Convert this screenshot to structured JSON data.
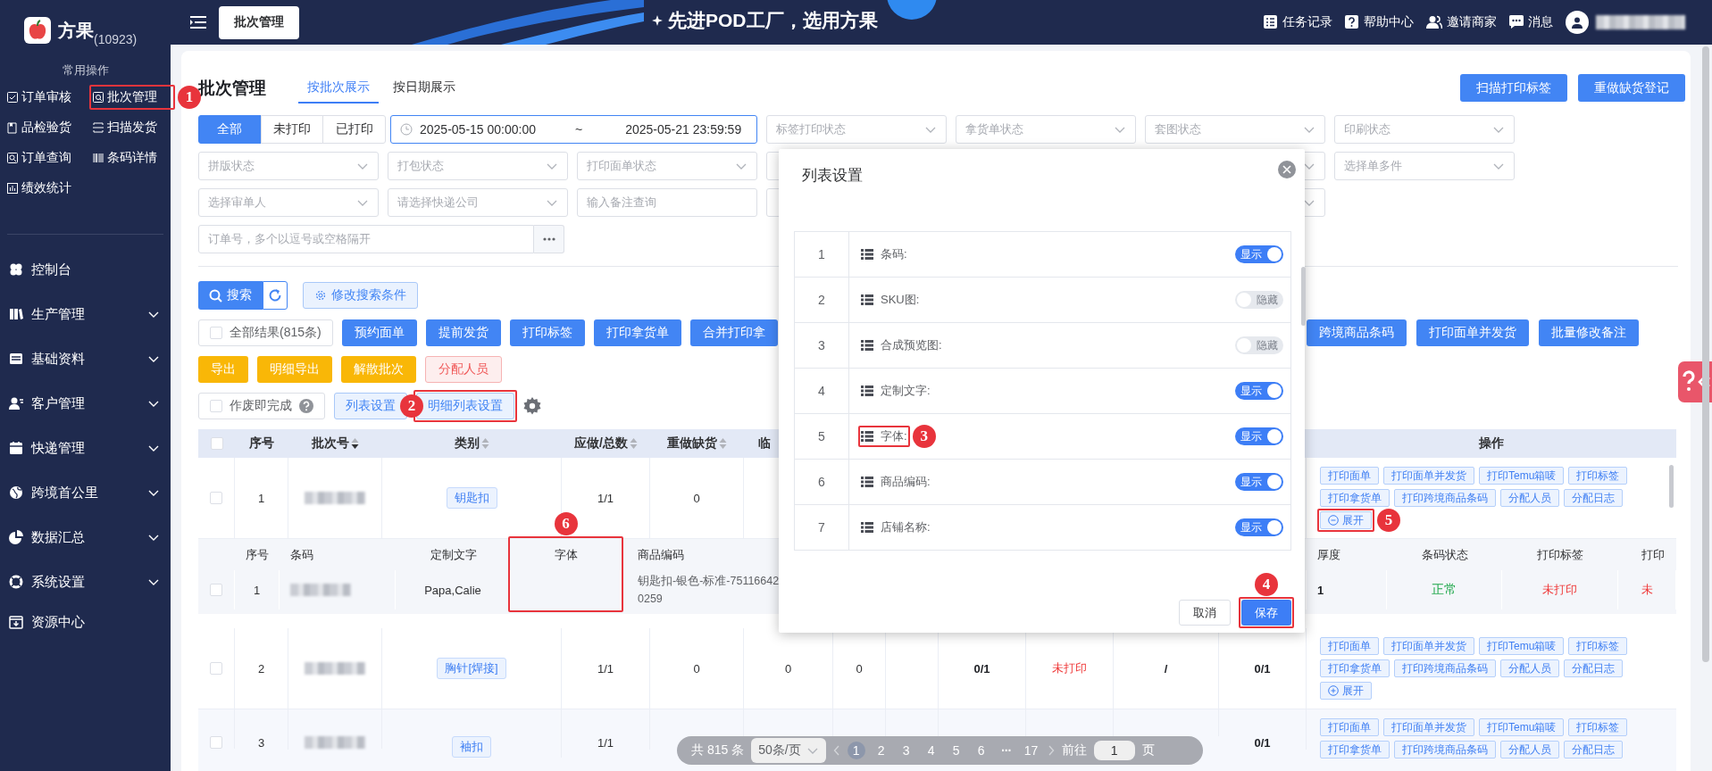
{
  "sidebar": {
    "logo": {
      "name": "方果",
      "count": "(10923)"
    },
    "quick_title": "常用操作",
    "quick_links": [
      {
        "label": "订单审核"
      },
      {
        "label": "批次管理",
        "callout": "1"
      },
      {
        "label": "品检验货"
      },
      {
        "label": "扫描发货"
      },
      {
        "label": "订单查询"
      },
      {
        "label": "条码详情"
      },
      {
        "label": "绩效统计"
      }
    ],
    "menu": [
      {
        "label": "控制台",
        "kind": "link"
      },
      {
        "label": "生产管理",
        "kind": "group",
        "expanded": false
      },
      {
        "label": "基础资料",
        "kind": "group",
        "expanded": false
      },
      {
        "label": "客户管理",
        "kind": "group",
        "expanded": false
      },
      {
        "label": "快递管理",
        "kind": "group",
        "expanded": false
      },
      {
        "label": "跨境首公里",
        "kind": "group",
        "expanded": false
      },
      {
        "label": "数据汇总",
        "kind": "group",
        "expanded": false
      },
      {
        "label": "系统设置",
        "kind": "group",
        "expanded": false
      },
      {
        "label": "资源中心",
        "kind": "link"
      }
    ]
  },
  "topbar": {
    "tabs": [
      {
        "label": "批次管理",
        "selected": true
      }
    ],
    "slogan": "先进POD工厂，选用方果",
    "links": [
      "任务记录",
      "帮助中心",
      "邀请商家",
      "消息"
    ],
    "user": {
      "redacted": true
    }
  },
  "page": {
    "title": "批次管理",
    "view_tabs": [
      {
        "label": "按批次展示",
        "selected": true
      },
      {
        "label": "按日期展示",
        "selected": false
      }
    ],
    "actions": [
      "扫描打印标签",
      "重做缺货登记"
    ],
    "print_filter": [
      {
        "label": "全部",
        "selected": true
      },
      {
        "label": "未打印",
        "selected": false
      },
      {
        "label": "已打印",
        "selected": false
      }
    ],
    "date_range": {
      "start": "2025-05-15 00:00:00",
      "separator": "~",
      "end": "2025-05-21 23:59:59"
    },
    "filters": [
      {
        "kind": "select",
        "placeholder": "标签打印状态"
      },
      {
        "kind": "select",
        "placeholder": "拿货单状态"
      },
      {
        "kind": "select",
        "placeholder": "套图状态"
      },
      {
        "kind": "select",
        "placeholder": "印刷状态"
      },
      {
        "kind": "select",
        "placeholder": "拼版状态"
      },
      {
        "kind": "select",
        "placeholder": "打包状态"
      },
      {
        "kind": "select",
        "placeholder": "打印面单状态"
      },
      {
        "kind": "select"
      },
      {
        "kind": "select"
      },
      {
        "kind": "select",
        "placeholder": "选择单多件"
      },
      {
        "kind": "select",
        "placeholder": "选择审单人"
      },
      {
        "kind": "select",
        "placeholder": "请选择快递公司"
      },
      {
        "kind": "input",
        "placeholder": "输入备注查询"
      },
      {
        "kind": "select"
      },
      {
        "kind": "select"
      },
      {
        "kind": "order",
        "placeholder": "订单号，多个以逗号或空格隔开"
      }
    ],
    "search_button": "搜索",
    "modify_button": "修改搜索条件",
    "all_results": {
      "label": "全部结果(815条)",
      "checked": false
    },
    "bulk_left": [
      "预约面单",
      "提前发货",
      "打印标签",
      "打印拿货单",
      "合并打印拿"
    ],
    "bulk_right": [
      "跨境商品条码",
      "打印面单并发货",
      "批量修改备注"
    ],
    "secondary": [
      {
        "label": "导出",
        "kind": "warning"
      },
      {
        "label": "明细导出",
        "kind": "warning"
      },
      {
        "label": "解散批次",
        "kind": "warning"
      },
      {
        "label": "分配人员",
        "kind": "danger"
      }
    ],
    "void_done": {
      "label": "作废即完成",
      "checked": false
    },
    "list_settings": "列表设置",
    "detail_settings": {
      "label": "明细列表设置",
      "callout": "2"
    }
  },
  "table": {
    "header_checked": false,
    "columns": [
      {
        "kind": "text",
        "label": "序号"
      },
      {
        "kind": "sortable",
        "label": "批次号",
        "sorted": true
      },
      {
        "kind": "sortable",
        "label": "类别",
        "sorted": false
      },
      {
        "kind": "sortable",
        "label": "应做/总数",
        "sorted": false
      },
      {
        "kind": "sortable",
        "label": "重做缺货",
        "sorted": false
      },
      {
        "kind": "text",
        "label": "临"
      },
      {
        "kind": "blank"
      },
      {
        "kind": "blank"
      },
      {
        "kind": "blank"
      },
      {
        "kind": "blank"
      },
      {
        "kind": "blank"
      },
      {
        "kind": "blank"
      },
      {
        "kind": "text",
        "label": "操作"
      }
    ],
    "rows": [
      {
        "checked": false,
        "cells": [
          {
            "kind": "plain",
            "text": "1"
          },
          {
            "kind": "redacted"
          },
          {
            "kind": "tag",
            "text": "钥匙扣"
          },
          {
            "kind": "plain",
            "text": "1/1"
          },
          {
            "kind": "plain",
            "text": "0"
          },
          {
            "kind": "blank"
          },
          {
            "kind": "blank"
          },
          {
            "kind": "blank"
          },
          {
            "kind": "blank"
          },
          {
            "kind": "blank"
          },
          {
            "kind": "blank"
          },
          {
            "kind": "blank"
          }
        ],
        "actions": [
          "打印面单",
          "打印面单并发货",
          "打印Temu箱唛",
          "打印标签",
          "打印拿货单",
          "打印跨境商品条码",
          "分配人员",
          "分配日志"
        ],
        "toggle": {
          "label": "展开",
          "expanded": true,
          "callout": "5"
        },
        "detail": {
          "columns_left": [
            {
              "label": "序号"
            },
            {
              "label": "条码"
            },
            {
              "label": "定制文字"
            },
            {
              "label": "字体",
              "callout": "6"
            },
            {
              "label": "商品编码"
            }
          ],
          "columns_right": [
            {
              "label": "厚度"
            },
            {
              "label": "条码状态"
            },
            {
              "label": "打印标签"
            },
            {
              "label": "打印"
            }
          ],
          "rows": [
            {
              "checked": false,
              "left": [
                {
                  "kind": "plain",
                  "text": "1"
                },
                {
                  "kind": "redacted"
                },
                {
                  "kind": "plain",
                  "text": "Papa,Calie"
                },
                {
                  "kind": "blank"
                },
                {
                  "kind": "wrap",
                  "text": "钥匙扣-银色-标准-751166420259"
                }
              ],
              "right": [
                {
                  "kind": "bold",
                  "text": "1"
                },
                {
                  "kind": "ok",
                  "text": "正常"
                },
                {
                  "kind": "alert",
                  "text": "未打印"
                },
                {
                  "kind": "alert",
                  "text": "未"
                }
              ]
            }
          ]
        }
      },
      {
        "checked": false,
        "cells": [
          {
            "kind": "plain",
            "text": "2"
          },
          {
            "kind": "redacted"
          },
          {
            "kind": "tag",
            "text": "胸针[焊接]"
          },
          {
            "kind": "plain",
            "text": "1/1"
          },
          {
            "kind": "plain",
            "text": "0"
          },
          {
            "kind": "plain",
            "text": "0"
          },
          {
            "kind": "plain",
            "text": "0"
          },
          {
            "kind": "blank"
          },
          {
            "kind": "bold",
            "text": "0/1"
          },
          {
            "kind": "alert",
            "text": "未打印"
          },
          {
            "kind": "bold",
            "text": "/"
          },
          {
            "kind": "bold",
            "text": "0/1"
          }
        ],
        "actions": [
          "打印面单",
          "打印面单并发货",
          "打印Temu箱唛",
          "打印标签",
          "打印拿货单",
          "打印跨境商品条码",
          "分配人员",
          "分配日志"
        ],
        "toggle": {
          "label": "展开",
          "expanded": false
        }
      },
      {
        "checked": false,
        "cells": [
          {
            "kind": "plain",
            "text": "3"
          },
          {
            "kind": "redacted"
          },
          {
            "kind": "tag",
            "text": "袖扣"
          },
          {
            "kind": "plain",
            "text": "1/1"
          },
          {
            "kind": "blank"
          },
          {
            "kind": "blank"
          },
          {
            "kind": "blank"
          },
          {
            "kind": "blank"
          },
          {
            "kind": "blank"
          },
          {
            "kind": "blank"
          },
          {
            "kind": "blank"
          },
          {
            "kind": "bold",
            "text": "0/1"
          }
        ],
        "actions": [
          "打印面单",
          "打印面单并发货",
          "打印Temu箱唛",
          "打印标签",
          "打印拿货单",
          "打印跨境商品条码",
          "分配人员",
          "分配日志"
        ]
      }
    ]
  },
  "modal": {
    "title": "列表设置",
    "rows": [
      {
        "no": "1",
        "label": "条码:",
        "on": true,
        "toggle_text": "显示"
      },
      {
        "no": "2",
        "label": "SKU图:",
        "on": false,
        "toggle_text": "隐藏"
      },
      {
        "no": "3",
        "label": "合成预览图:",
        "on": false,
        "toggle_text": "隐藏"
      },
      {
        "no": "4",
        "label": "定制文字:",
        "on": true,
        "toggle_text": "显示"
      },
      {
        "no": "5",
        "label": "字体:",
        "on": true,
        "toggle_text": "显示",
        "callout": "3"
      },
      {
        "no": "6",
        "label": "商品编码:",
        "on": true,
        "toggle_text": "显示"
      },
      {
        "no": "7",
        "label": "店铺名称:",
        "on": true,
        "toggle_text": "显示"
      }
    ],
    "cancel": "取消",
    "save": {
      "label": "保存",
      "callout": "4"
    }
  },
  "pagination": {
    "total": "共 815 条",
    "page_size": "50条/页",
    "pages": [
      {
        "label": "1",
        "kind": "page",
        "selected": true
      },
      {
        "label": "2",
        "kind": "page",
        "selected": false
      },
      {
        "label": "3",
        "kind": "page",
        "selected": false
      },
      {
        "label": "4",
        "kind": "page",
        "selected": false
      },
      {
        "label": "5",
        "kind": "page",
        "selected": false
      },
      {
        "label": "6",
        "kind": "page",
        "selected": false
      },
      {
        "label": "···",
        "kind": "more",
        "selected": false
      },
      {
        "label": "17",
        "kind": "page",
        "selected": false
      }
    ],
    "goto": "前往",
    "goto_value": "1",
    "page_unit": "页"
  }
}
